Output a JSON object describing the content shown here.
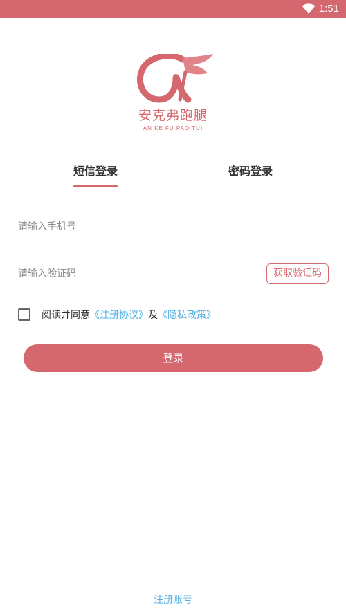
{
  "status_bar": {
    "time": "1:51",
    "wifi_icon": "wifi-icon"
  },
  "logo": {
    "brand_name": "安克弗跑腿",
    "pinyin": "AN KE FU PAO TUI"
  },
  "tabs": [
    {
      "label": "短信登录",
      "active": true
    },
    {
      "label": "密码登录",
      "active": false
    }
  ],
  "form": {
    "phone_placeholder": "请输入手机号",
    "phone_value": "",
    "code_placeholder": "请输入验证码",
    "code_value": "",
    "get_code_label": "获取验证码"
  },
  "agreement": {
    "checked": false,
    "prefix": "阅读并同意",
    "terms_link": "《注册协议》",
    "and": "及",
    "privacy_link": "《隐私政策》"
  },
  "login_button": "登录",
  "register_link": "注册账号",
  "colors": {
    "accent": "#d5676f",
    "link": "#4fb0e6"
  }
}
